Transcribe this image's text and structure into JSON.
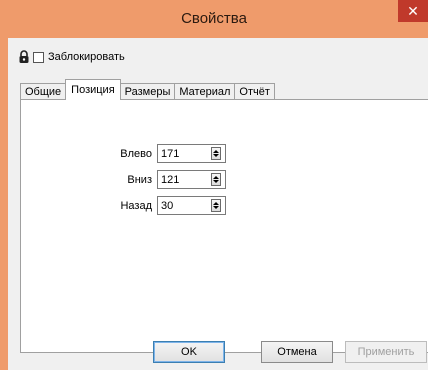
{
  "window": {
    "title": "Свойства",
    "close_glyph": "✕"
  },
  "lock": {
    "label": "Заблокировать",
    "checked": false
  },
  "tabs": [
    {
      "label": "Общие",
      "active": false
    },
    {
      "label": "Позиция",
      "active": true
    },
    {
      "label": "Размеры",
      "active": false
    },
    {
      "label": "Материал",
      "active": false
    },
    {
      "label": "Отчёт",
      "active": false
    }
  ],
  "fields": [
    {
      "label": "Влево",
      "value": "171"
    },
    {
      "label": "Вниз",
      "value": "121"
    },
    {
      "label": "Назад",
      "value": "30"
    }
  ],
  "buttons": {
    "ok": "OK",
    "cancel": "Отмена",
    "apply": "Применить"
  },
  "colors": {
    "accent": "#ef9b6b",
    "close": "#c0392b"
  }
}
